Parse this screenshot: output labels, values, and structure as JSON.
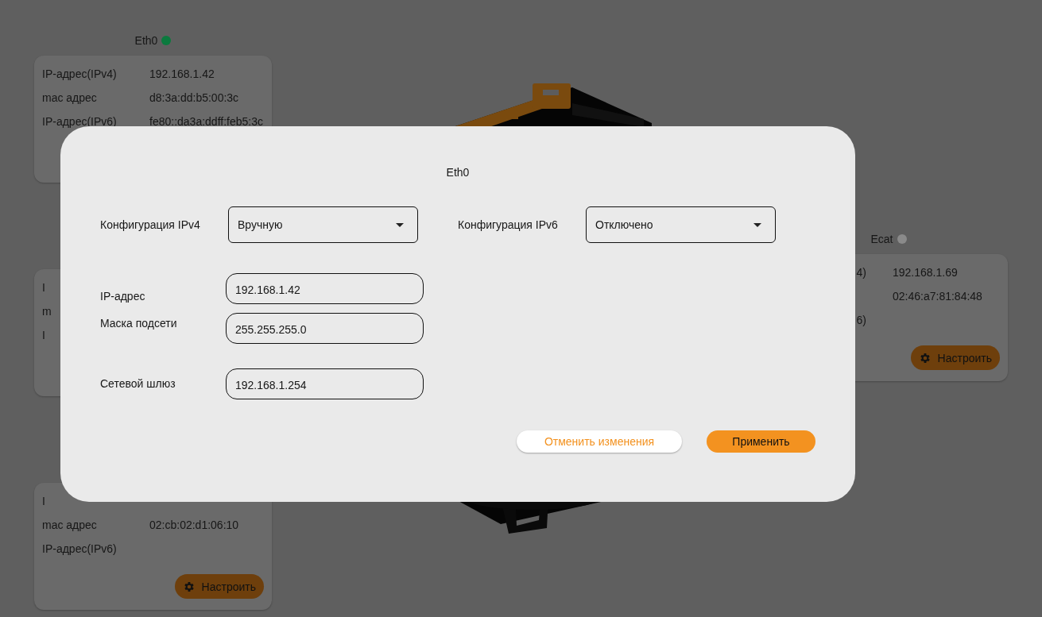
{
  "background": {
    "interfaces": [
      {
        "name": "Eth0",
        "color": "#0b7a3e",
        "rows": [
          {
            "label": "IP-адрес(IPv4)",
            "value": "192.168.1.42"
          },
          {
            "label": "mac адрес",
            "value": "d8:3a:dd:b5:00:3c"
          },
          {
            "label": "IP-адрес(IPv6)",
            "value": "fe80::da3a:ddff:feb5:3c"
          }
        ]
      },
      {
        "rows": [
          {
            "label": "I"
          },
          {
            "label": "m"
          },
          {
            "label": "I"
          }
        ]
      },
      {
        "rows": [
          {
            "label": "I"
          },
          {
            "label": "mac адрес",
            "value": "02:cb:02:d1:06:10"
          },
          {
            "label": "IP-адрес(IPv6)"
          }
        ],
        "button": "Настроить"
      }
    ],
    "side_interface": {
      "name": "Ecat",
      "color": "#8a8a8a",
      "rows": [
        {
          "label": "4)",
          "value": "192.168.1.69"
        },
        {
          "value": "02:46:a7:81:84:48"
        },
        {
          "label": "6)"
        }
      ],
      "button": "Настроить"
    }
  },
  "dialog": {
    "title": "Eth0",
    "ipv4_config": {
      "label": "Конфигурация IPv4",
      "value": "Вручную"
    },
    "ipv6_config": {
      "label": "Конфигурация IPv6",
      "value": "Отключено"
    },
    "fields": [
      {
        "label": "IP-адрес",
        "value": "192.168.1.42"
      },
      {
        "label": "Маска подсети",
        "value": "255.255.255.0"
      },
      {
        "label": "Сетевой шлюз",
        "value": "192.168.1.254"
      }
    ],
    "buttons": [
      {
        "label": "Отменить изменения",
        "kind": "secondary"
      },
      {
        "label": "Применить",
        "kind": "primary"
      }
    ]
  }
}
